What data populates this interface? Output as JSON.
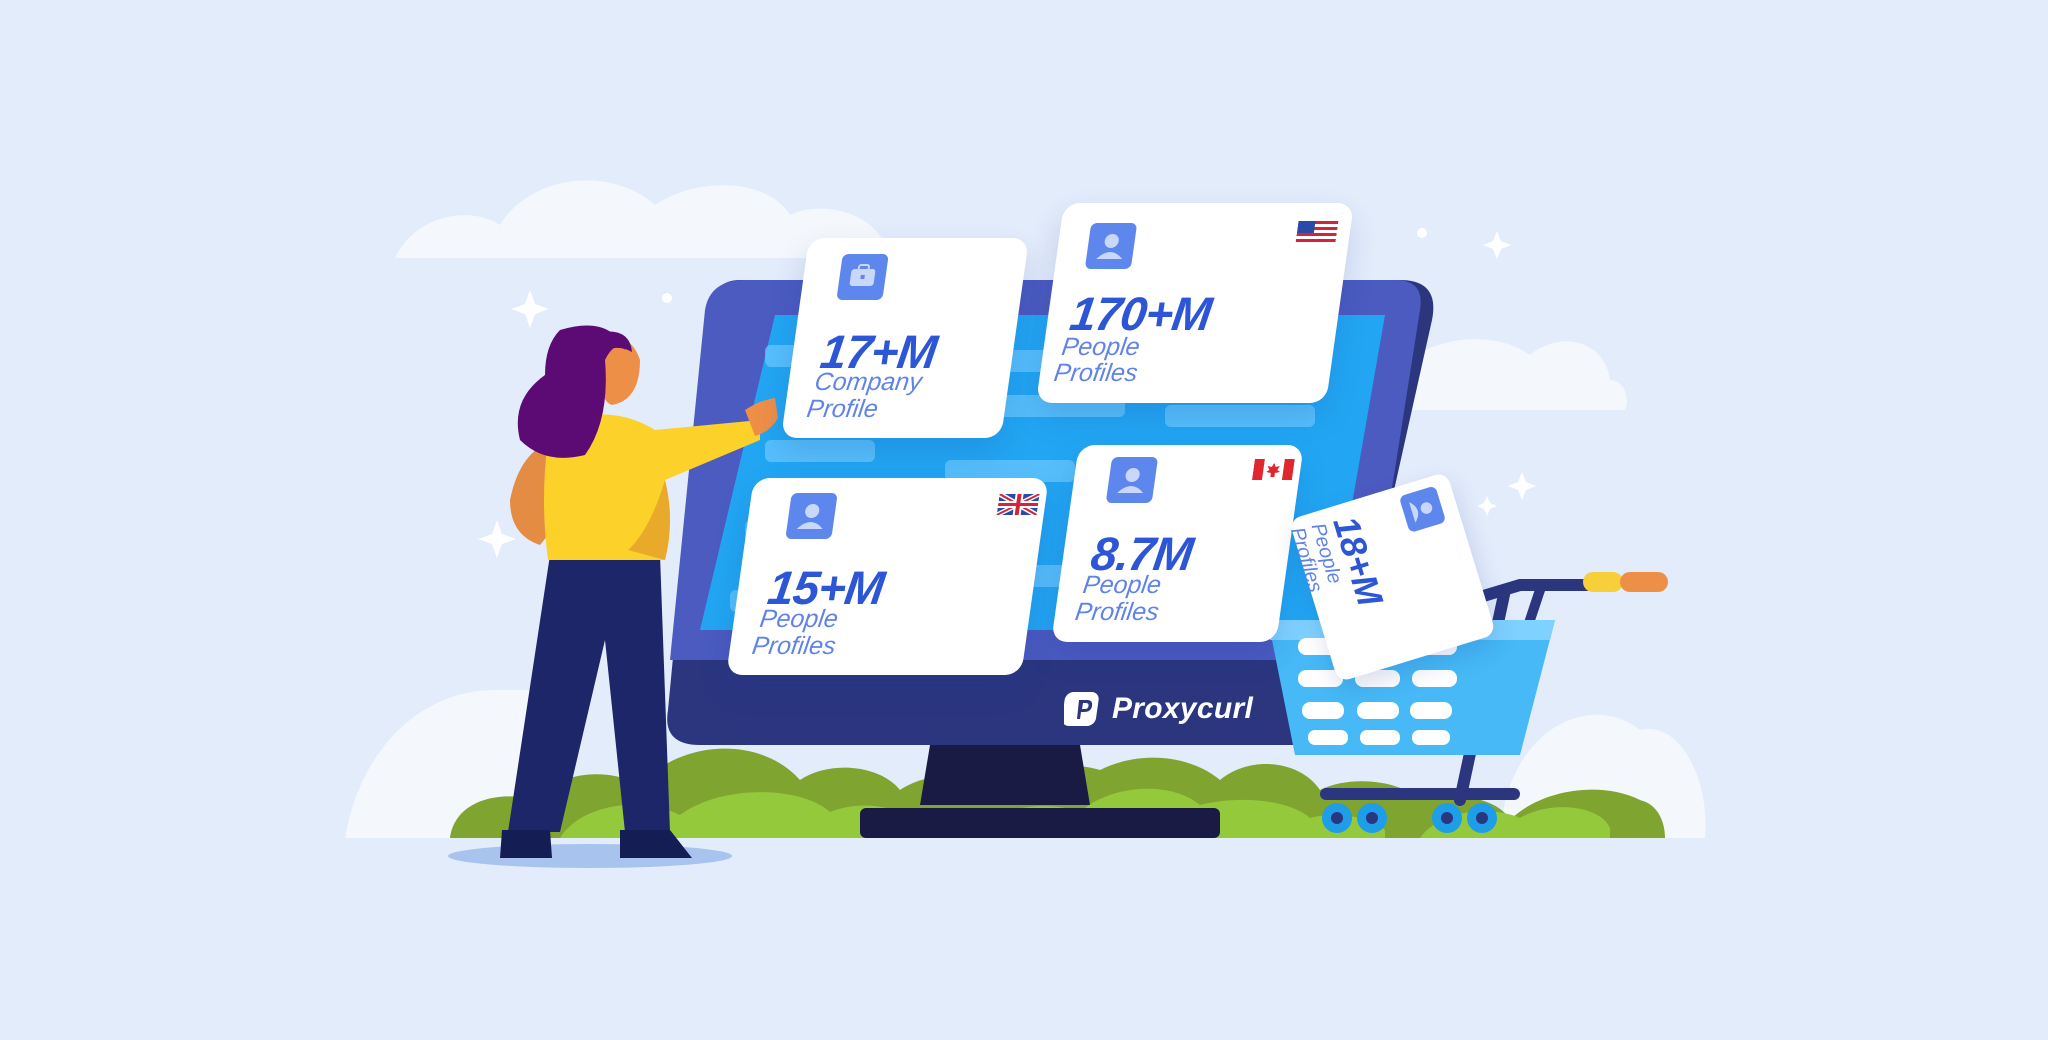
{
  "brand": {
    "name": "Proxycurl",
    "colors": {
      "background": "#e3ecfb",
      "monitor": "#2b367f",
      "screen": "#22a6f3",
      "stat_blue": "#2d56d6",
      "label_blue": "#5f83e8"
    }
  },
  "cards": [
    {
      "id": "company",
      "icon": "briefcase-icon",
      "flag": "",
      "value": "17+M",
      "label_lines": [
        "Company",
        "Profile"
      ]
    },
    {
      "id": "us",
      "icon": "person-icon",
      "flag": "us-flag-icon",
      "value": "170+M",
      "label_lines": [
        "People",
        "Profiles"
      ]
    },
    {
      "id": "uk",
      "icon": "person-icon",
      "flag": "uk-flag-icon",
      "value": "15+M",
      "label_lines": [
        "People",
        "Profiles"
      ]
    },
    {
      "id": "ca",
      "icon": "person-icon",
      "flag": "canada-flag-icon",
      "value": "8.7M",
      "label_lines": [
        "People",
        "Profiles"
      ]
    },
    {
      "id": "cart",
      "icon": "person-icon",
      "flag": "",
      "value": "18+M",
      "label_lines": [
        "People",
        "Profiles"
      ]
    }
  ]
}
